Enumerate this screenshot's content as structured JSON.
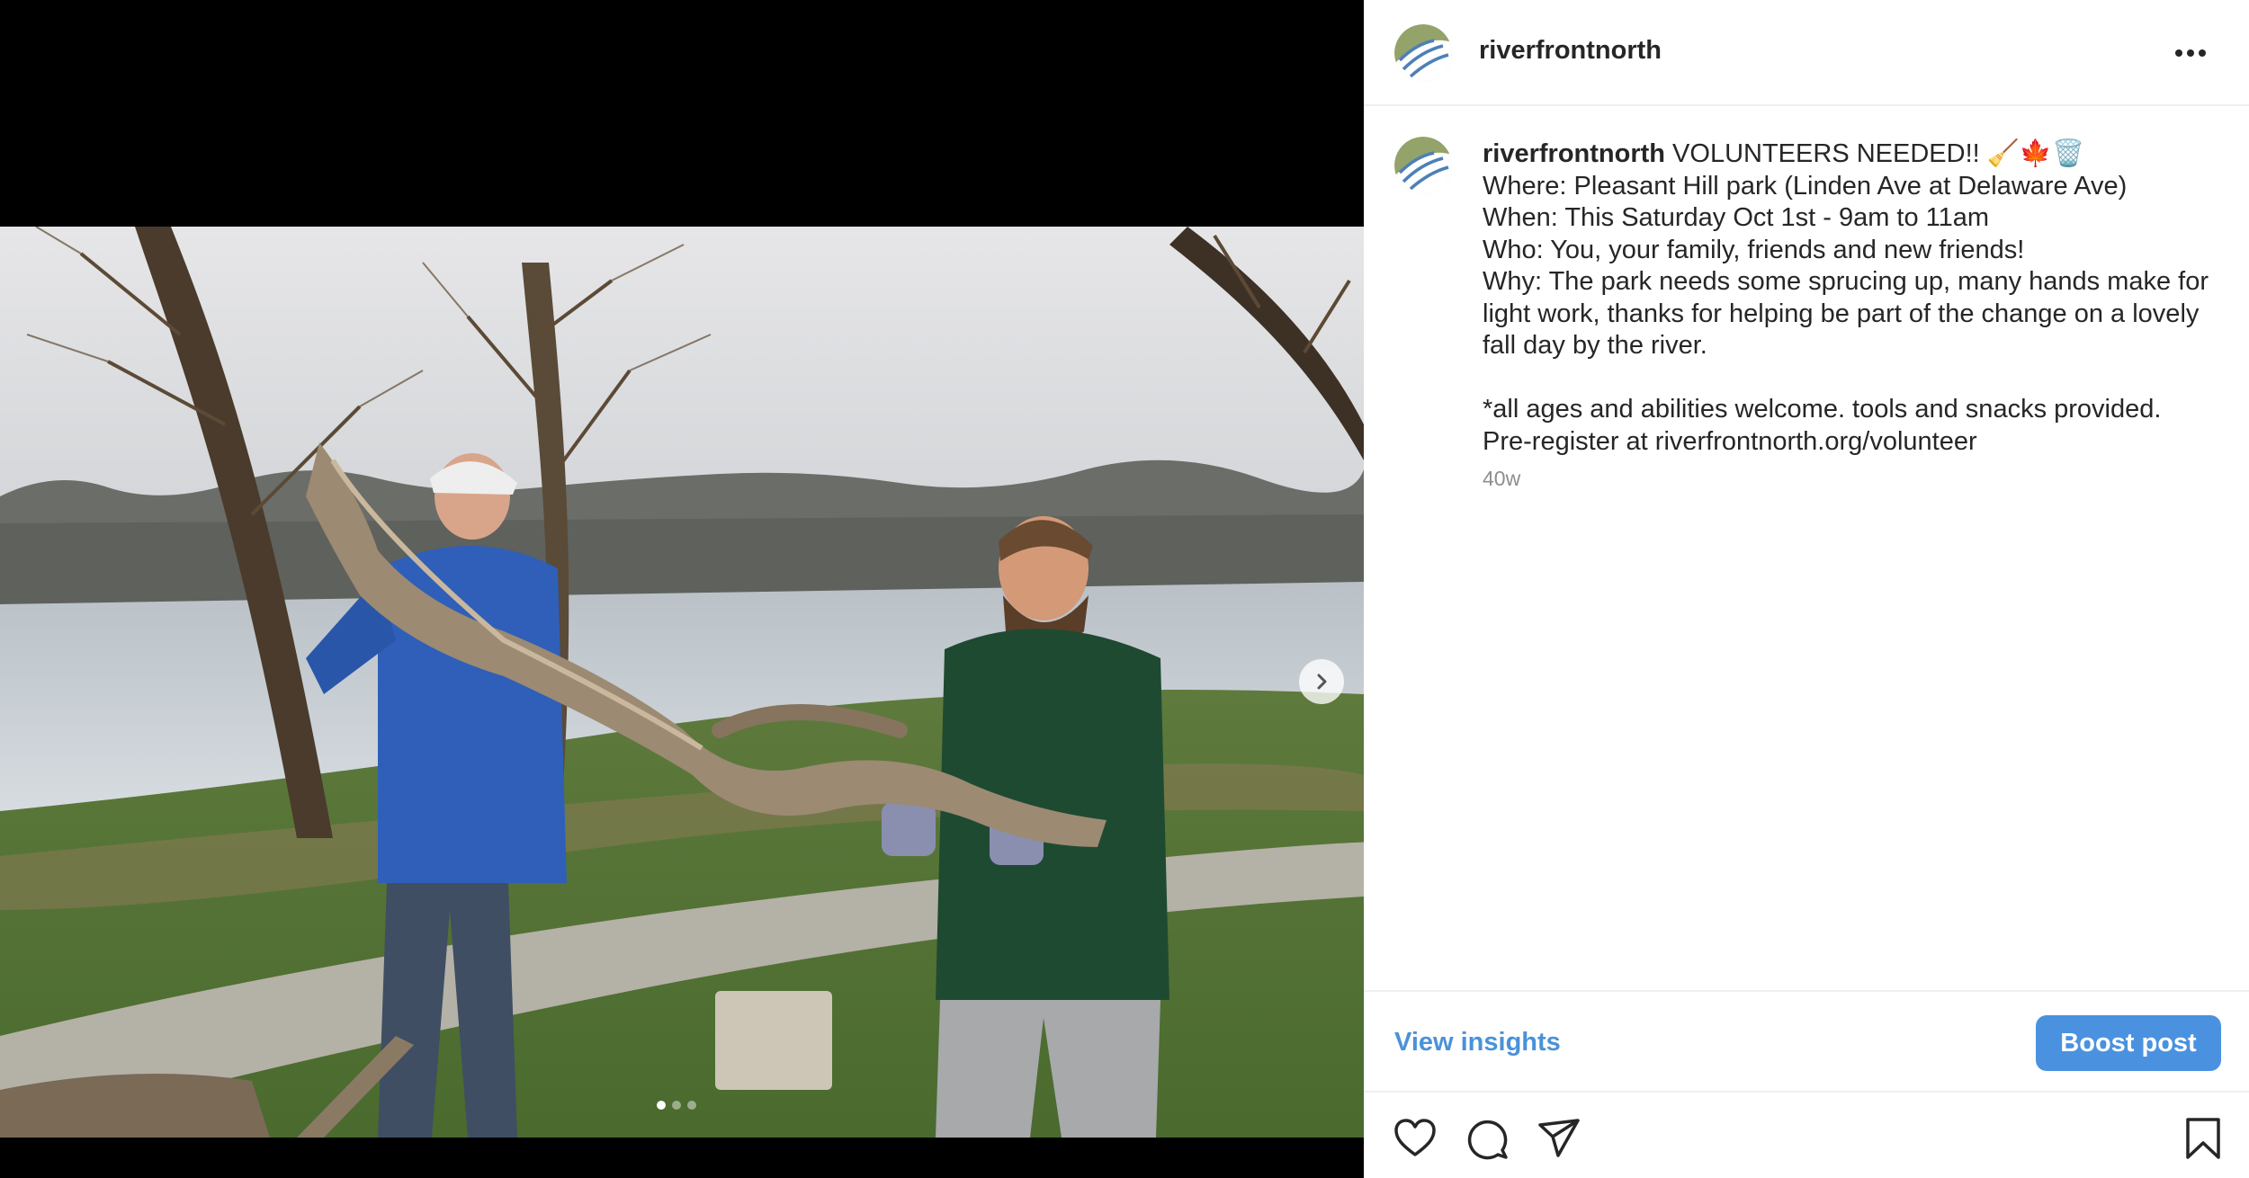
{
  "post": {
    "username": "riverfrontnorth",
    "more_icon": "more-horizontal-icon",
    "caption": {
      "username": "riverfrontnorth",
      "first_line": " VOLUNTEERS NEEDED!! 🧹🍁🗑️",
      "lines": [
        "Where: Pleasant Hill park (Linden Ave at Delaware Ave)",
        "When: This Saturday Oct 1st - 9am to 11am",
        "Who: You, your family, friends and new friends!",
        "Why: The park needs some sprucing up, many hands make for",
        "light work, thanks for helping be part of the change on a lovely",
        "fall day by the river.",
        "",
        "*all ages and abilities welcome. tools and snacks provided.",
        "Pre-register at riverfrontnorth.org/volunteer"
      ]
    },
    "timestamp": "40w"
  },
  "media": {
    "alt": "Two volunteers carrying a large driftwood log by the river",
    "carousel_total": 3,
    "carousel_current": 1,
    "next_icon": "chevron-right-icon"
  },
  "insights": {
    "view_insights_label": "View insights",
    "boost_label": "Boost post"
  },
  "actions": {
    "icons": [
      "heart-icon",
      "comment-icon",
      "share-icon",
      "bookmark-icon"
    ]
  },
  "colors": {
    "link_blue": "#4a92d8",
    "button_blue": "#4a92e0",
    "text": "#262626",
    "muted": "#8e8e8e"
  }
}
